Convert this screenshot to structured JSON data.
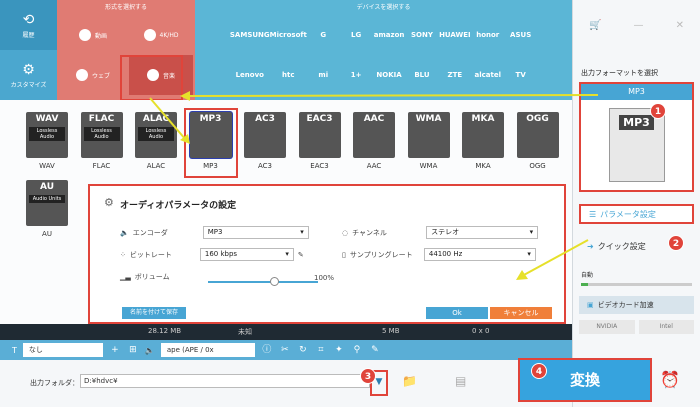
{
  "nav": {
    "history_label": "履歴",
    "customize_label": "カスタマイズ"
  },
  "category_bar": {
    "heading": "形式を選択する",
    "items": [
      {
        "label": "動画",
        "icon": "video-icon"
      },
      {
        "label": "4K/HD",
        "icon": "4k-icon"
      },
      {
        "label": "ウェブ",
        "icon": "chrome-icon"
      },
      {
        "label": "音楽",
        "icon": "speaker-icon",
        "selected": true
      }
    ]
  },
  "device_bar": {
    "heading": "デバイスを選択する",
    "row1": [
      "",
      "SAMSUNG",
      "Microsoft",
      "G",
      "LG",
      "amazon",
      "SONY",
      "HUAWEI",
      "honor",
      "ASUS",
      ""
    ],
    "row2": [
      "",
      "Lenovo",
      "htc",
      "mi",
      "1+",
      "NOKIA",
      "BLU",
      "ZTE",
      "alcatel",
      "TV",
      ""
    ]
  },
  "formats": {
    "row1": [
      {
        "label": "WAV",
        "sub": "Lossless Audio"
      },
      {
        "label": "FLAC",
        "sub": "Lossless Audio"
      },
      {
        "label": "ALAC",
        "sub": "Lossless Audio"
      },
      {
        "label": "MP3",
        "sub": "",
        "highlighted": true
      },
      {
        "label": "AC3",
        "sub": ""
      },
      {
        "label": "EAC3",
        "sub": ""
      },
      {
        "label": "AAC",
        "sub": ""
      },
      {
        "label": "WMA",
        "sub": ""
      },
      {
        "label": "MKA",
        "sub": ""
      },
      {
        "label": "OGG",
        "sub": ""
      }
    ],
    "row2": [
      {
        "label": "AU",
        "sub": "Audio Units"
      }
    ]
  },
  "dialog": {
    "title": "オーディオパラメータの設定",
    "encoder_label": "エンコーダ",
    "encoder_value": "MP3",
    "bitrate_label": "ビットレート",
    "bitrate_value": "160 kbps",
    "volume_label": "ボリューム",
    "volume_value": "100%",
    "volume_level": 0.6,
    "channel_label": "チャンネル",
    "channel_value": "ステレオ",
    "samplerate_label": "サンプリングレート",
    "samplerate_value": "44100 Hz",
    "save_label": "名前を付けて保存",
    "ok_label": "Ok",
    "cancel_label": "キャンセル"
  },
  "info": {
    "size1": "28.12 MB",
    "unknown": "未知",
    "size2": "5 MB",
    "dims": "0 x 0"
  },
  "toolbar": {
    "subtitle_value": "なし",
    "audio_value": "ape (APE / 0x"
  },
  "output": {
    "label": "出力フォルダ：",
    "path": "D:¥hdvc¥"
  },
  "right_panel": {
    "format_label": "出力フォーマットを選択",
    "selected_format": "MP3",
    "param_label": "パラメータ設定",
    "quick_label": "クイック設定",
    "auto_label": "自動",
    "gpu_label": "ビデオカード加速",
    "vendors": [
      "NVIDIA",
      "Intel"
    ]
  },
  "convert_label": "変換",
  "badges": [
    "1",
    "2",
    "3",
    "4"
  ]
}
